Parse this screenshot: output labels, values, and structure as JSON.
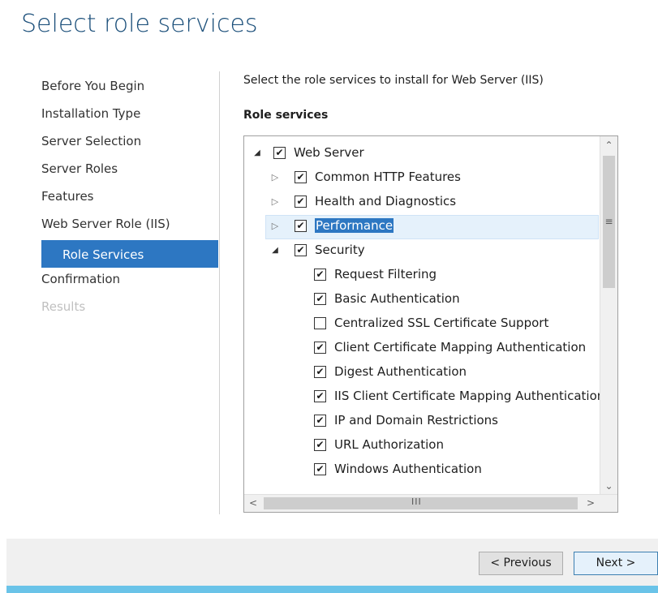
{
  "page": {
    "title": "Select role services"
  },
  "nav": {
    "items": [
      {
        "label": "Before You Begin",
        "state": "normal"
      },
      {
        "label": "Installation Type",
        "state": "normal"
      },
      {
        "label": "Server Selection",
        "state": "normal"
      },
      {
        "label": "Server Roles",
        "state": "normal"
      },
      {
        "label": "Features",
        "state": "normal"
      },
      {
        "label": "Web Server Role (IIS)",
        "state": "normal"
      },
      {
        "label": "Role Services",
        "state": "selected"
      },
      {
        "label": "Confirmation",
        "state": "normal"
      },
      {
        "label": "Results",
        "state": "disabled"
      }
    ]
  },
  "main": {
    "description": "Select the role services to install for Web Server (IIS)",
    "section_heading": "Role services",
    "tree": [
      {
        "label": "Web Server",
        "checked": true,
        "expander": "expanded",
        "level": 0
      },
      {
        "label": "Common HTTP Features",
        "checked": true,
        "expander": "collapsed",
        "level": 1
      },
      {
        "label": "Health and Diagnostics",
        "checked": true,
        "expander": "collapsed",
        "level": 1
      },
      {
        "label": "Performance",
        "checked": true,
        "expander": "collapsed",
        "level": 1,
        "selected": true
      },
      {
        "label": "Security",
        "checked": true,
        "expander": "expanded",
        "level": 1
      },
      {
        "label": "Request Filtering",
        "checked": true,
        "expander": "none",
        "level": 2
      },
      {
        "label": "Basic Authentication",
        "checked": true,
        "expander": "none",
        "level": 2
      },
      {
        "label": "Centralized SSL Certificate Support",
        "checked": false,
        "expander": "none",
        "level": 2
      },
      {
        "label": "Client Certificate Mapping Authentication",
        "checked": true,
        "expander": "none",
        "level": 2
      },
      {
        "label": "Digest Authentication",
        "checked": true,
        "expander": "none",
        "level": 2
      },
      {
        "label": "IIS Client Certificate Mapping Authentication",
        "checked": true,
        "expander": "none",
        "level": 2
      },
      {
        "label": "IP and Domain Restrictions",
        "checked": true,
        "expander": "none",
        "level": 2
      },
      {
        "label": "URL Authorization",
        "checked": true,
        "expander": "none",
        "level": 2
      },
      {
        "label": "Windows Authentication",
        "checked": true,
        "expander": "none",
        "level": 2
      }
    ],
    "scroll_position": 0.0
  },
  "icons": {
    "checkmark": "✔",
    "expand": "▷",
    "collapse": "◢",
    "scroll_up": "⌃",
    "scroll_down": "⌄",
    "scroll_left": "<",
    "scroll_right": ">",
    "grip_v": "≡",
    "grip_h": "III"
  },
  "footer": {
    "previous_label": "< Previous",
    "next_label": "Next >"
  },
  "colors": {
    "accent": "#2d77c2",
    "title": "#1b4f7a",
    "footer_line": "#6ac3e8"
  }
}
